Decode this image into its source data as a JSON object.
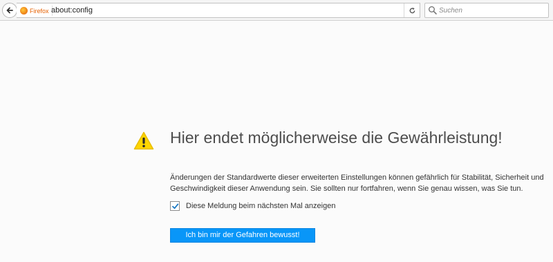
{
  "toolbar": {
    "identity_label": "Firefox",
    "url": "about:config",
    "search_placeholder": "Suchen"
  },
  "warning": {
    "title": "Hier endet möglicherweise die Gewährleistung!",
    "description_line1": "Änderungen der Standardwerte dieser erweiterten Einstellungen können gefährlich für Stabilität, Sicherheit und",
    "description_line2": "Geschwindigkeit dieser Anwendung sein. Sie sollten nur fortfahren, wenn Sie genau wissen, was Sie tun.",
    "checkbox_label": "Diese Meldung beim nächsten Mal anzeigen",
    "checkbox_checked": true,
    "accept_button_label": "Ich bin mir der Gefahren bewusst!"
  },
  "colors": {
    "accent": "#0996f8",
    "warning_icon": "#ffd500",
    "identity": "#e66000"
  },
  "icons": {
    "back": "back-arrow-icon",
    "reload": "reload-icon",
    "search": "search-icon",
    "warning": "warning-icon",
    "check": "checkmark-icon"
  }
}
